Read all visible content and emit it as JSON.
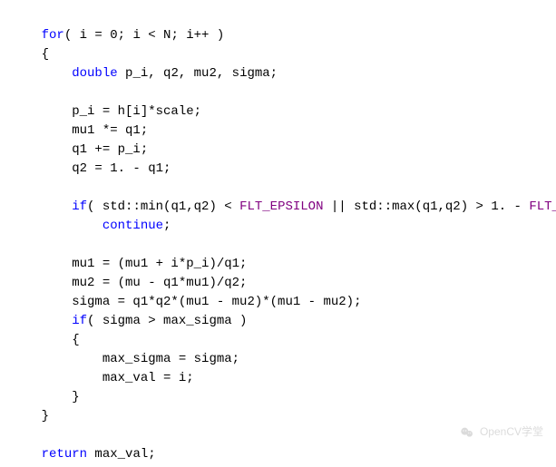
{
  "code": {
    "l1": {
      "a": "for",
      "b": "( i = 0; i < N; i++ )"
    },
    "l2": "{",
    "l3": {
      "a": "double",
      "b": " p_i, q2, mu2, sigma;"
    },
    "l4": "",
    "l5": "p_i = h[i]*scale;",
    "l6": "mu1 *= q1;",
    "l7": "q1 += p_i;",
    "l8": "q2 = 1. - q1;",
    "l9": "",
    "l10": {
      "a": "if",
      "b": "( std::min(q1,q2) < ",
      "c": "FLT_EPSILON",
      "d": " || std::max(q1,q2) > 1. - ",
      "e": "FLT_EPSILON",
      "f": " )"
    },
    "l11": "continue",
    "l11b": ";",
    "l12": "",
    "l13": "mu1 = (mu1 + i*p_i)/q1;",
    "l14": "mu2 = (mu - q1*mu1)/q2;",
    "l15": "sigma = q1*q2*(mu1 - mu2)*(mu1 - mu2);",
    "l16": {
      "a": "if",
      "b": "( sigma > max_sigma )"
    },
    "l17": "{",
    "l18": "max_sigma = sigma;",
    "l19": "max_val = i;",
    "l20": "}",
    "l21": "}",
    "l22": "",
    "l23": {
      "a": "return",
      "b": " max_val;"
    }
  },
  "watermark": {
    "text": "OpenCV学堂"
  }
}
